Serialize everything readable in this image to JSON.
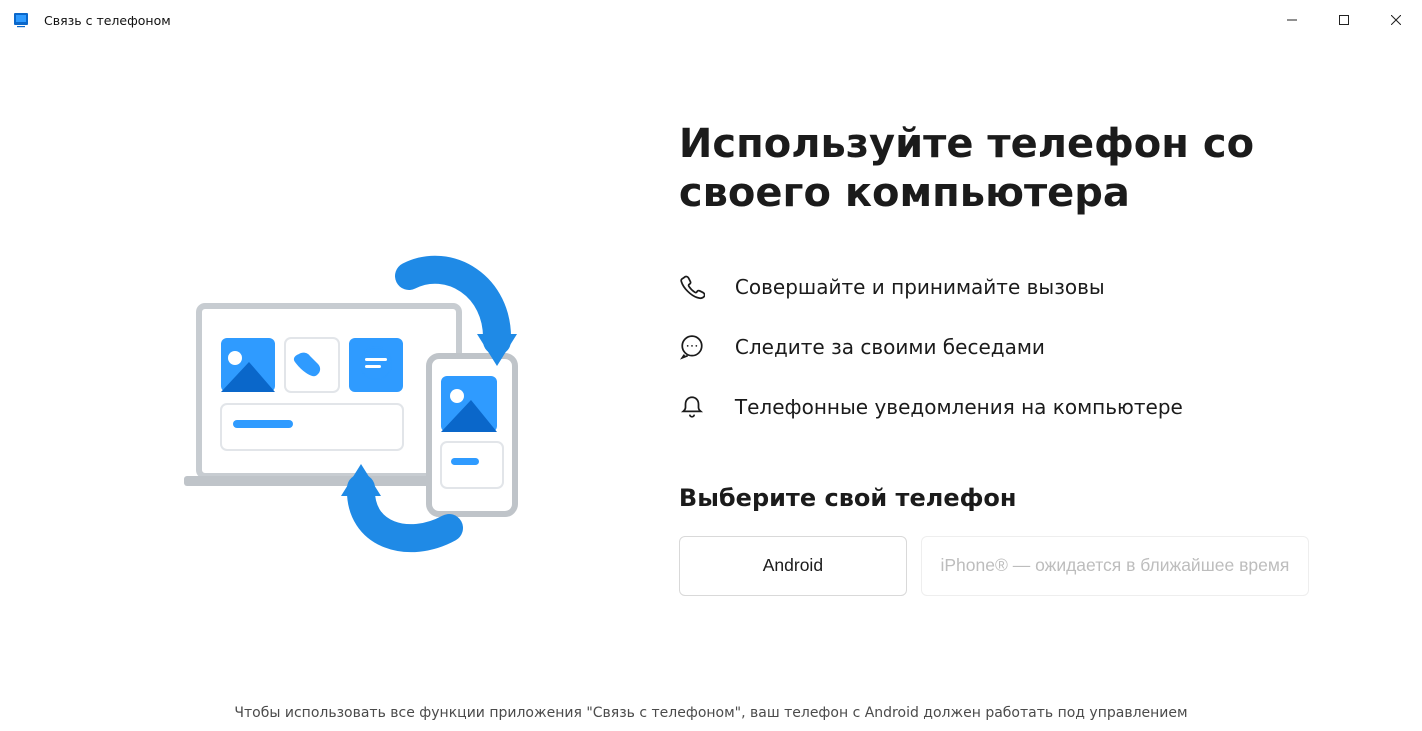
{
  "window": {
    "title": "Связь с телефоном"
  },
  "main": {
    "heading": "Используйте телефон со своего компьютера",
    "features": [
      "Совершайте и принимайте вызовы",
      "Следите за своими беседами",
      "Телефонные уведомления на компьютере"
    ],
    "choose_label": "Выберите свой телефон",
    "android_button": "Android",
    "iphone_button": "iPhone® — ожидается в ближайшее время"
  },
  "footer": {
    "text": "Чтобы использовать все функции приложения \"Связь с телефоном\", ваш телефон с Android должен работать под управлением"
  }
}
